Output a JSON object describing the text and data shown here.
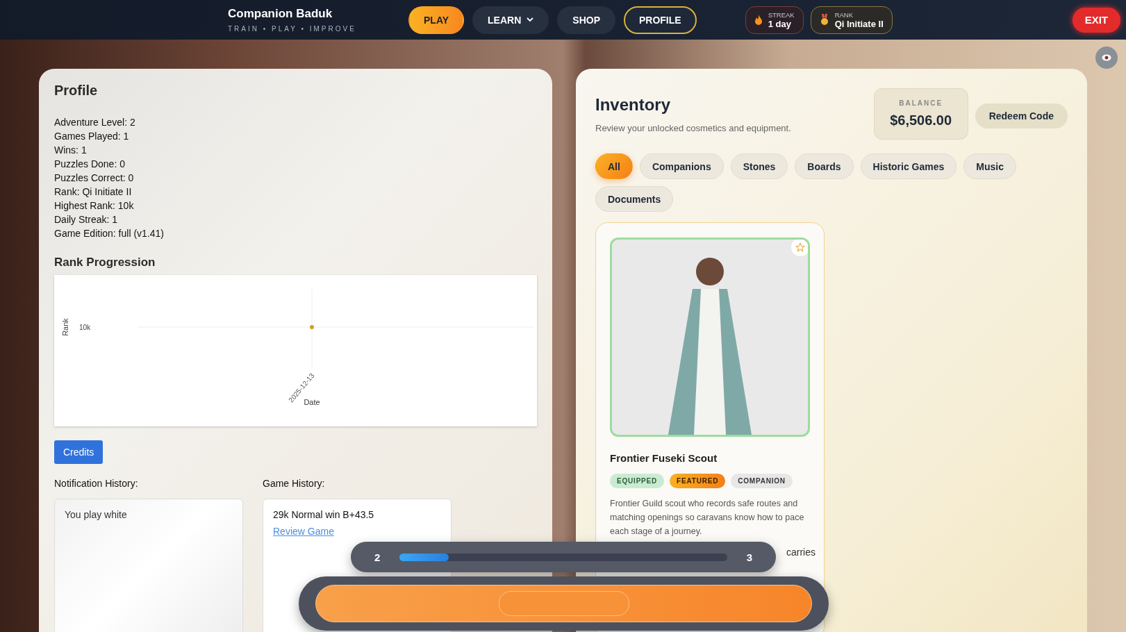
{
  "topbar": {
    "title": "Companion Baduk",
    "subtitle": "TRAIN • PLAY • IMPROVE",
    "nav": [
      {
        "label": "PLAY",
        "kind": "primary",
        "selected": false
      },
      {
        "label": "LEARN",
        "kind": "dropdown",
        "selected": false
      },
      {
        "label": "SHOP",
        "kind": "plain",
        "selected": false
      },
      {
        "label": "PROFILE",
        "kind": "plain",
        "selected": true
      }
    ],
    "chips": [
      {
        "kind": "streak",
        "label": "STREAK",
        "value": "1 day"
      },
      {
        "kind": "rank",
        "label": "RANK",
        "value": "Qi Initiate II"
      }
    ],
    "exit": "EXIT"
  },
  "profile": {
    "title": "Profile",
    "stats": [
      "Adventure Level: 2",
      "Games Played: 1",
      "Wins: 1",
      "Puzzles Done: 0",
      "Puzzles Correct: 0",
      "Rank: Qi Initiate II",
      "Highest Rank: 10k",
      "Daily Streak: 1",
      "Game Edition: full (v1.41)"
    ],
    "chart_title": "Rank Progression",
    "chart": {
      "xlabel": "Date",
      "ylabel": "Rank",
      "x_tick": "2025-12-13",
      "y_tick": "10k"
    },
    "credits": "Credits",
    "notifications": {
      "label": "Notification History:",
      "items": [
        "You play white"
      ]
    },
    "games": {
      "label": "Game History:",
      "items": [
        {
          "result": "29k Normal win B+43.5",
          "link": "Review Game"
        }
      ]
    }
  },
  "inventory": {
    "title": "Inventory",
    "subtitle": "Review your unlocked cosmetics and equipment.",
    "balance": {
      "label": "BALANCE",
      "value": "$6,506.00"
    },
    "redeem": "Redeem Code",
    "filters": [
      {
        "label": "All",
        "selected": true
      },
      {
        "label": "Companions",
        "selected": false
      },
      {
        "label": "Stones",
        "selected": false
      },
      {
        "label": "Boards",
        "selected": false
      },
      {
        "label": "Historic Games",
        "selected": false
      },
      {
        "label": "Music",
        "selected": false
      },
      {
        "label": "Documents",
        "selected": false
      }
    ],
    "items": [
      {
        "name": "Frontier Fuseki Scout",
        "favorite": false,
        "tags": [
          {
            "label": "EQUIPPED",
            "kind": "equipped"
          },
          {
            "label": "FEATURED",
            "kind": "featured"
          },
          {
            "label": "COMPANION",
            "kind": "type"
          }
        ],
        "description": "Frontier Guild scout who records safe routes and matching openings so caravans know how to pace each stage of a journey.",
        "description_tail": "carries"
      }
    ]
  },
  "level_bar": {
    "from": "2",
    "to": "3",
    "level": 0.15
  },
  "action_slider": {
    "level": 0.5
  }
}
